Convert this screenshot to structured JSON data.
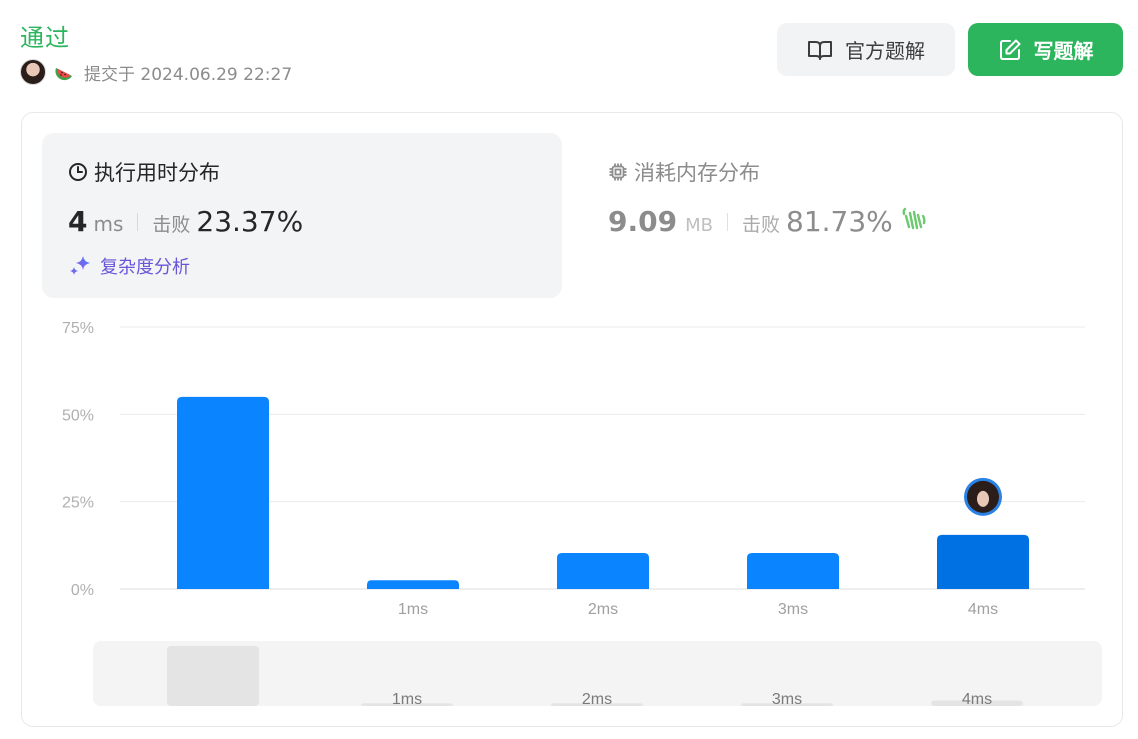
{
  "header": {
    "status": "通过",
    "submitted": "提交于 2024.06.29 22:27",
    "solution_button": "官方题解",
    "write_button": "写题解"
  },
  "runtime": {
    "title": "执行用时分布",
    "value": "4",
    "unit": "ms",
    "beat_label": "击败",
    "beat_pct": "23.37%",
    "complexity_link": "复杂度分析"
  },
  "memory": {
    "title": "消耗内存分布",
    "value": "9.09",
    "unit": "MB",
    "beat_label": "击败",
    "beat_pct": "81.73%"
  },
  "colors": {
    "accent_green": "#2db55d",
    "bar_blue": "#0a84ff",
    "bar_highlight": "#0071e3",
    "nav_bar": "#e4e4e4"
  },
  "chart_data": {
    "type": "bar",
    "categories": [
      "",
      "1ms",
      "2ms",
      "3ms",
      "4ms"
    ],
    "values": [
      55,
      2.5,
      10.3,
      10.3,
      15.5
    ],
    "yticks": [
      "75%",
      "50%",
      "25%",
      "0%"
    ],
    "ylim": [
      0,
      75
    ],
    "highlight_index": 4,
    "grid": true,
    "navigator": {
      "labels": [
        "1ms",
        "2ms",
        "3ms",
        "4ms"
      ],
      "values": [
        55,
        2.5,
        2.5,
        2.5,
        5
      ]
    }
  }
}
